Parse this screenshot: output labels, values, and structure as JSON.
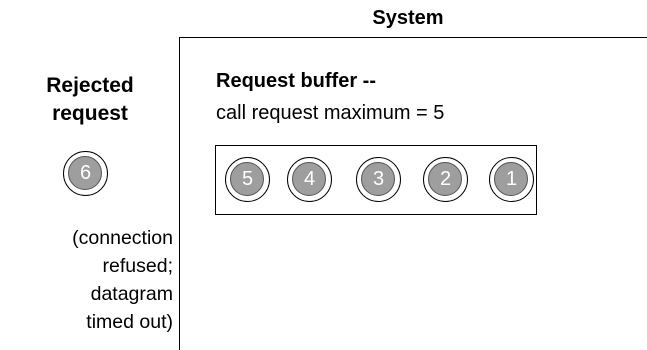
{
  "system": {
    "label": "System"
  },
  "rejected": {
    "title": "Rejected\nrequest",
    "request_number": "6",
    "note": "(connection\nrefused;\ndatagram\ntimed out)"
  },
  "buffer": {
    "title": "Request buffer --",
    "subtitle": "call request maximum = 5",
    "requests": [
      "5",
      "4",
      "3",
      "2",
      "1"
    ]
  },
  "colors": {
    "circle_fill": "#9e9e9e",
    "line": "#000000",
    "background": "#ffffff"
  }
}
